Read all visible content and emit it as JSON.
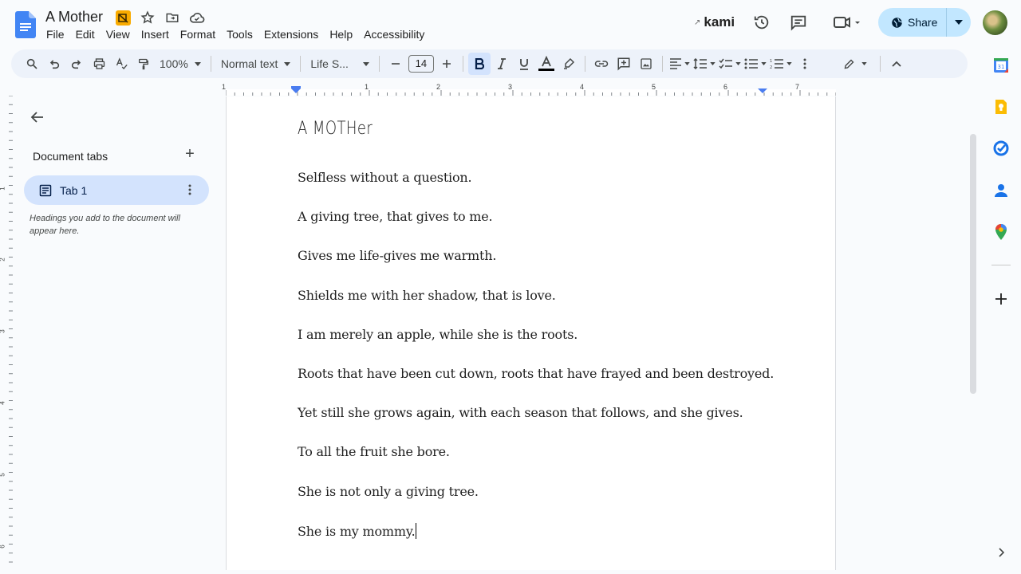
{
  "header": {
    "title": "A Mother",
    "menu": [
      "File",
      "Edit",
      "View",
      "Insert",
      "Format",
      "Tools",
      "Extensions",
      "Help",
      "Accessibility"
    ],
    "kami_label": "kami",
    "share_label": "Share"
  },
  "toolbar": {
    "zoom": "100%",
    "style": "Normal text",
    "font": "Life S...",
    "font_size": "14"
  },
  "ruler": {
    "numbers": [
      "1",
      "1",
      "2",
      "3",
      "4",
      "5",
      "6",
      "7"
    ],
    "vnumbers": [
      "1",
      "2",
      "3",
      "4",
      "5",
      "6"
    ]
  },
  "sidebar": {
    "heading": "Document tabs",
    "tab_label": "Tab 1",
    "hint": "Headings you add to the document will appear here."
  },
  "document": {
    "title": "A MOTHer",
    "lines": [
      "Selfless without a question.",
      "A giving tree, that gives to me.",
      "Gives me life-gives me warmth.",
      "Shields me with her shadow, that is love.",
      "I am merely an apple, while she is the roots.",
      "Roots that have been cut down, roots that have frayed and been destroyed.",
      "Yet still she grows again, with each season that follows, and she gives.",
      "To all the fruit she bore.",
      "She is not only a giving tree.",
      "She is my mommy."
    ]
  },
  "colors": {
    "accent": "#0b57d0",
    "toolbar_bg": "#edf2fa",
    "share_bg": "#c2e7ff",
    "tab_active_bg": "#d3e3fd"
  }
}
